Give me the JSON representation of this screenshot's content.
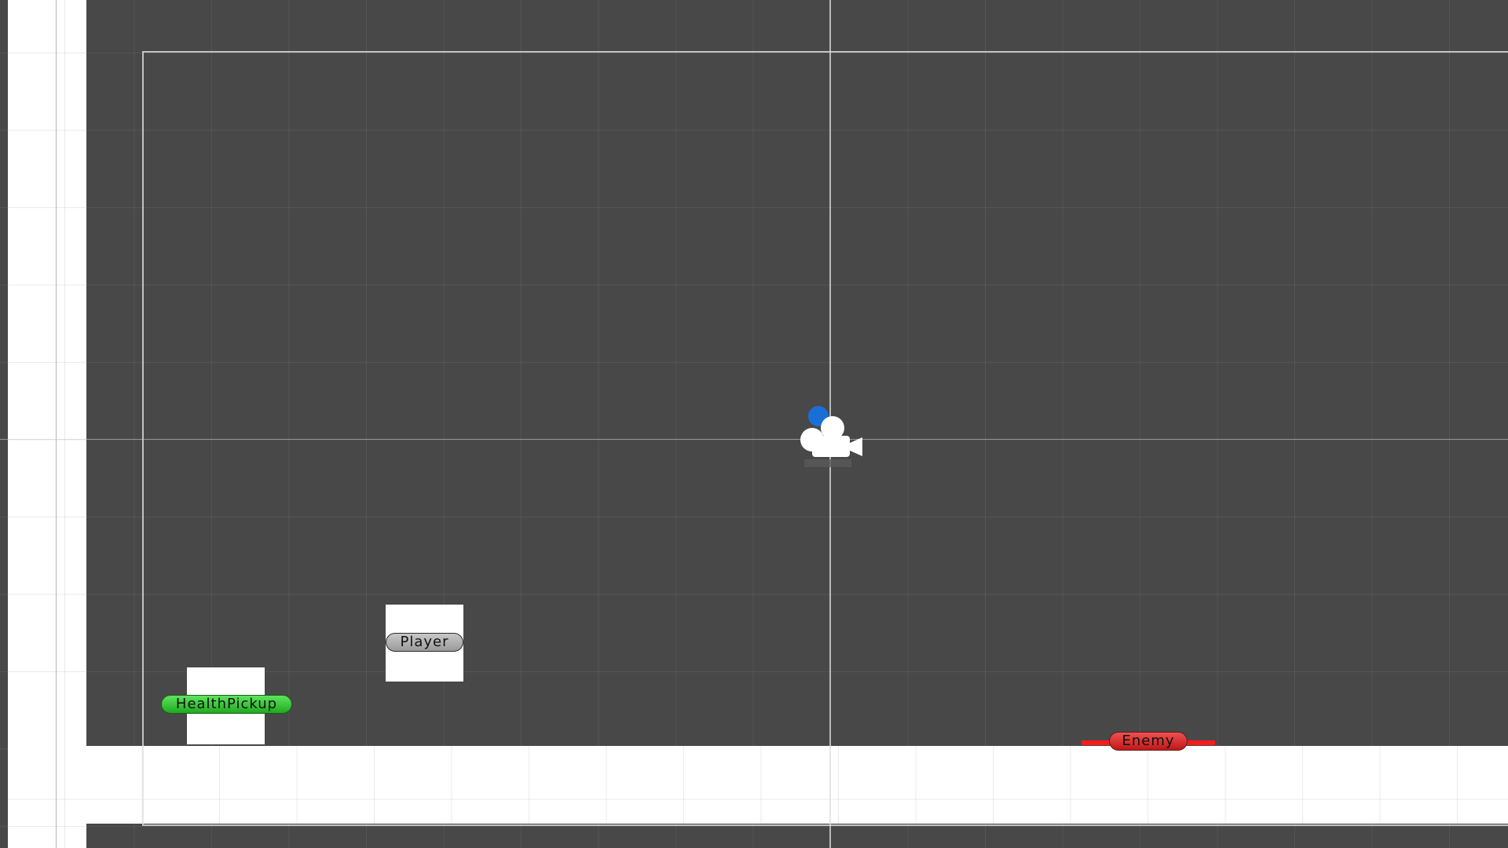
{
  "scene": {
    "objects": {
      "player": {
        "label": "Player"
      },
      "health_pickup": {
        "label": "HealthPickup"
      },
      "enemy": {
        "label": "Enemy"
      }
    },
    "icons": {
      "camera": "camera-icon"
    },
    "colors": {
      "background": "#484848",
      "sprite": "#ffffff",
      "label_default": "#aaaaaa",
      "label_pickup": "#2ecc2e",
      "label_enemy": "#e02424",
      "enemy_bar": "#ff1a1a",
      "camera_dot": "#1a6fd6"
    }
  }
}
